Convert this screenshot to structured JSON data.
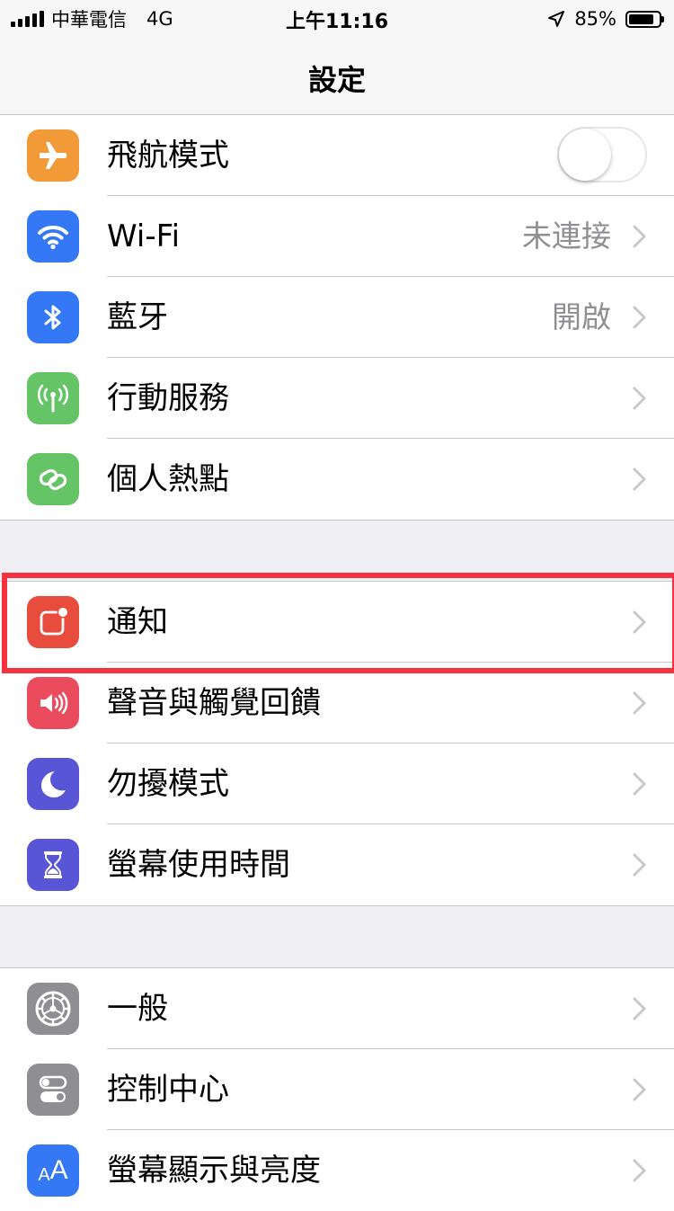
{
  "status_bar": {
    "carrier": "中華電信",
    "network": "4G",
    "time": "上午11:16",
    "battery_percent": "85%",
    "battery_level": 0.85,
    "location_icon": "location-arrow-icon",
    "signal_icon": "signal-bars-icon",
    "battery_icon": "battery-icon"
  },
  "nav": {
    "title": "設定"
  },
  "colors": {
    "orange": "#f19a37",
    "blue": "#3478f6",
    "green": "#65c466",
    "red": "#e74c3c",
    "pink": "#ea4c5e",
    "indigo": "#5856d6",
    "gray": "#8e8e93",
    "highlight": "#f5333f"
  },
  "groups": [
    {
      "rows": [
        {
          "label": "飛航模式",
          "icon": "airplane-icon",
          "toggle_on": false
        },
        {
          "label": "Wi-Fi",
          "icon": "wifi-icon",
          "value": "未連接"
        },
        {
          "label": "藍牙",
          "icon": "bluetooth-icon",
          "value": "開啟"
        },
        {
          "label": "行動服務",
          "icon": "cellular-antenna-icon"
        },
        {
          "label": "個人熱點",
          "icon": "hotspot-chain-icon"
        }
      ]
    },
    {
      "rows": [
        {
          "label": "通知",
          "icon": "notifications-icon"
        },
        {
          "label": "聲音與觸覺回饋",
          "icon": "speaker-icon"
        },
        {
          "label": "勿擾模式",
          "icon": "moon-icon"
        },
        {
          "label": "螢幕使用時間",
          "icon": "hourglass-icon"
        }
      ]
    },
    {
      "rows": [
        {
          "label": "一般",
          "icon": "gear-icon"
        },
        {
          "label": "控制中心",
          "icon": "toggles-icon"
        },
        {
          "label": "螢幕顯示與亮度",
          "icon": "text-size-icon",
          "icon_text": "AA"
        }
      ]
    }
  ]
}
